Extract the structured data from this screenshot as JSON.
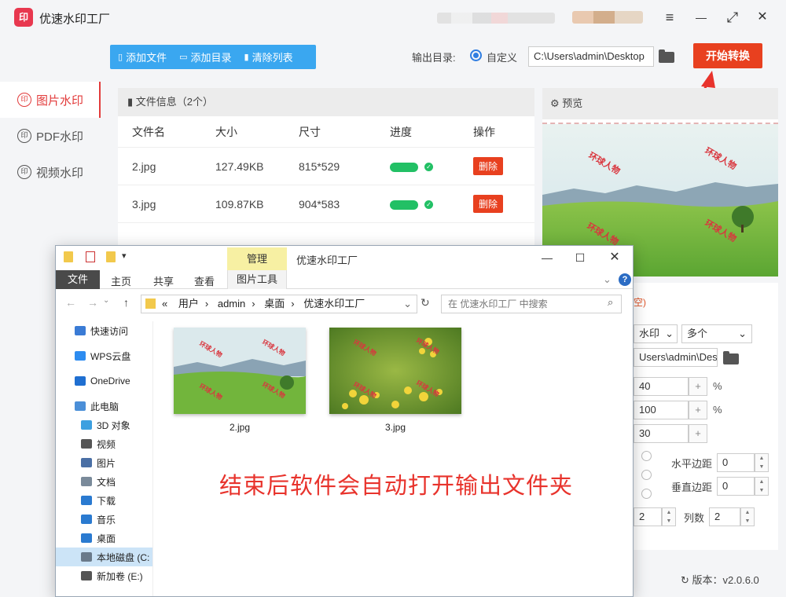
{
  "app": {
    "title": "优速水印工厂",
    "logo_text": "印"
  },
  "window_controls": {
    "menu": "≡",
    "minimize": "—",
    "maximize": "⤢",
    "close": "✕"
  },
  "sidebar": {
    "items": [
      {
        "label": "图片水印",
        "icon": "印",
        "active": true
      },
      {
        "label": "PDF水印",
        "icon": "印",
        "active": false
      },
      {
        "label": "视频水印",
        "icon": "印",
        "active": false
      }
    ]
  },
  "toolbar": {
    "add_file": "添加文件",
    "add_dir": "添加目录",
    "clear_list": "清除列表",
    "output_label": "输出目录:",
    "output_option": "自定义",
    "output_path": "C:\\Users\\admin\\Desktop",
    "start": "开始转换"
  },
  "file_panel": {
    "header": "文件信息（2个）",
    "columns": [
      "文件名",
      "大小",
      "尺寸",
      "进度",
      "操作"
    ],
    "rows": [
      {
        "name": "2.jpg",
        "size": "127.49KB",
        "dims": "815*529",
        "delete": "删除"
      },
      {
        "name": "3.jpg",
        "size": "109.87KB",
        "dims": "904*583",
        "delete": "删除"
      }
    ]
  },
  "preview": {
    "header": "预览",
    "watermark_text": "环球人物"
  },
  "settings": {
    "tag_partial": "空)",
    "type_select": "水印",
    "count_select": "多个",
    "dir_path": "Users\\admin\\Des",
    "opacity": "40",
    "scale": "100",
    "rotate": "30",
    "pct": "%",
    "h_margin_label": "水平边距",
    "h_margin": "0",
    "v_margin_label": "垂直边距",
    "v_margin": "0",
    "rows_value": "2",
    "cols_label": "列数",
    "cols_value": "2"
  },
  "version": {
    "label": "版本：v2.0.6.0"
  },
  "explorer": {
    "manage_tab": "管理",
    "title": "优速水印工厂",
    "ribbon": {
      "file": "文件",
      "home": "主页",
      "share": "共享",
      "view": "查看",
      "tools": "图片工具"
    },
    "address": [
      "«",
      "用户",
      "admin",
      "桌面",
      "优速水印工厂"
    ],
    "search_placeholder": "在 优速水印工厂 中搜索",
    "nav": [
      {
        "label": "快速访问",
        "icon": "star-icon",
        "color": "#3a7bd5"
      },
      {
        "label": "WPS云盘",
        "icon": "cloud-icon",
        "color": "#2d8cf0"
      },
      {
        "label": "OneDrive",
        "icon": "onedrive-icon",
        "color": "#1f6fd1"
      },
      {
        "label": "此电脑",
        "icon": "computer-icon",
        "color": "#4b8fd8"
      },
      {
        "label": "3D 对象",
        "icon": "cube-icon",
        "color": "#3da0e0"
      },
      {
        "label": "视频",
        "icon": "video-icon",
        "color": "#555555"
      },
      {
        "label": "图片",
        "icon": "picture-icon",
        "color": "#4a6fa5"
      },
      {
        "label": "文档",
        "icon": "document-icon",
        "color": "#7a8a9a"
      },
      {
        "label": "下载",
        "icon": "download-icon",
        "color": "#2a7ad0"
      },
      {
        "label": "音乐",
        "icon": "music-icon",
        "color": "#2a7ad0"
      },
      {
        "label": "桌面",
        "icon": "desktop-icon",
        "color": "#2a7ad0"
      },
      {
        "label": "本地磁盘 (C:",
        "icon": "disk-icon",
        "color": "#6a7a8a",
        "selected": true
      },
      {
        "label": "新加卷 (E:)",
        "icon": "drive-icon",
        "color": "#555555"
      }
    ],
    "files": [
      {
        "label": "2.jpg"
      },
      {
        "label": "3.jpg"
      }
    ],
    "note": "结束后软件会自动打开输出文件夹"
  },
  "colors": {
    "accent_red": "#e8401f",
    "toolbar_blue": "#3aa7f0",
    "progress_green": "#22c065"
  }
}
